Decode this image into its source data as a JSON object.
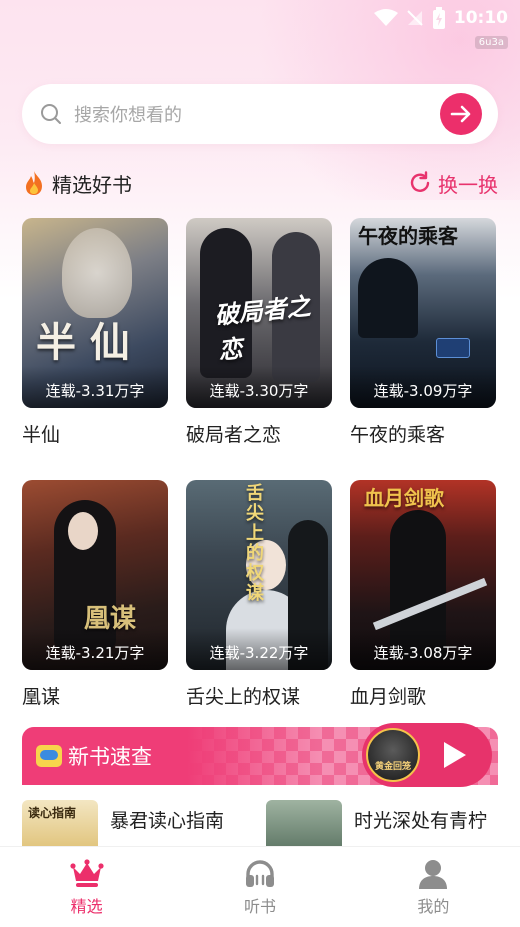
{
  "status_bar": {
    "time": "10:10",
    "badge": "6u3a"
  },
  "search": {
    "placeholder": "搜索你想看的"
  },
  "section": {
    "title": "精选好书",
    "refresh_label": "换一换"
  },
  "books": [
    {
      "name": "半仙",
      "status": "连载-3.31万字",
      "art": "半 仙"
    },
    {
      "name": "破局者之恋",
      "status": "连载-3.30万字",
      "art": "破局者之恋"
    },
    {
      "name": "午夜的乘客",
      "status": "连载-3.09万字",
      "art": "午夜的乘客"
    },
    {
      "name": "凰谋",
      "status": "连载-3.21万字",
      "art": "凰谋"
    },
    {
      "name": "舌尖上的权谋",
      "status": "连载-3.22万字",
      "art": "舌尖上的权谋"
    },
    {
      "name": "血月剑歌",
      "status": "连载-3.08万字",
      "art": "血月剑歌"
    }
  ],
  "new_books": {
    "banner_label": "新书速查",
    "thumb_text": "黄金回笼",
    "items": [
      {
        "title": "暴君读心指南"
      },
      {
        "title": "时光深处有青柠"
      }
    ]
  },
  "tabs": [
    {
      "label": "精选",
      "icon": "crown-icon",
      "active": true
    },
    {
      "label": "听书",
      "icon": "headphones-icon",
      "active": false
    },
    {
      "label": "我的",
      "icon": "user-icon",
      "active": false
    }
  ],
  "colors": {
    "accent": "#ec2f6b",
    "banner": "#ef3d77"
  }
}
